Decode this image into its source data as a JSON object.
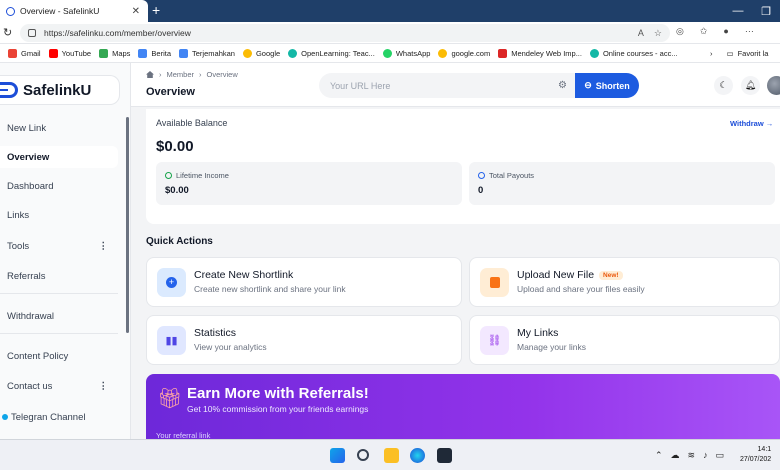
{
  "browser": {
    "tab_title": "Overview - SafelinkU",
    "url": "https://safelinku.com/member/overview",
    "bookmarks": [
      "Gmail",
      "YouTube",
      "Maps",
      "Berita",
      "Terjemahkan",
      "Google",
      "OpenLearning: Teac...",
      "WhatsApp",
      "google.com",
      "Mendeley Web Imp...",
      "Online courses - acc..."
    ],
    "bookmarks_more": "Favorit la"
  },
  "sidebar": {
    "brand": "SafelinkU",
    "items": [
      {
        "label": "New Link"
      },
      {
        "label": "Overview"
      },
      {
        "label": "Dashboard"
      },
      {
        "label": "Links"
      },
      {
        "label": "Tools"
      },
      {
        "label": "Referrals"
      },
      {
        "label": "Withdrawal"
      },
      {
        "label": "Content Policy"
      },
      {
        "label": "Contact us"
      },
      {
        "label": "Telegran Channel"
      }
    ]
  },
  "header": {
    "breadcrumb": [
      "Member",
      "Overview"
    ],
    "title": "Overview",
    "search_placeholder": "Your URL Here",
    "shorten_label": "Shorten"
  },
  "balance": {
    "label": "Available Balance",
    "value": "$0.00",
    "withdraw_link": "Withdraw →",
    "lifetime_label": "Lifetime Income",
    "lifetime_value": "$0.00",
    "payouts_label": "Total Payouts",
    "payouts_value": "0"
  },
  "quick_actions": {
    "title": "Quick Actions",
    "cards": [
      {
        "title": "Create New Shortlink",
        "subtitle": "Create new shortlink and share your link"
      },
      {
        "title": "Upload New File",
        "badge": "New!",
        "subtitle": "Upload and share your files easily"
      },
      {
        "title": "Statistics",
        "subtitle": "View your analytics"
      },
      {
        "title": "My Links",
        "subtitle": "Manage your links"
      }
    ]
  },
  "promo": {
    "title": "Earn More with Referrals!",
    "subtitle": "Get 10% commission from your friends earnings",
    "referral_label": "Your referral link"
  },
  "taskbar": {
    "time": "14:1",
    "date": "27/07/202"
  },
  "colors": {
    "primary": "#1d5be0",
    "promo_start": "#6d28d9",
    "promo_end": "#a855f7"
  }
}
